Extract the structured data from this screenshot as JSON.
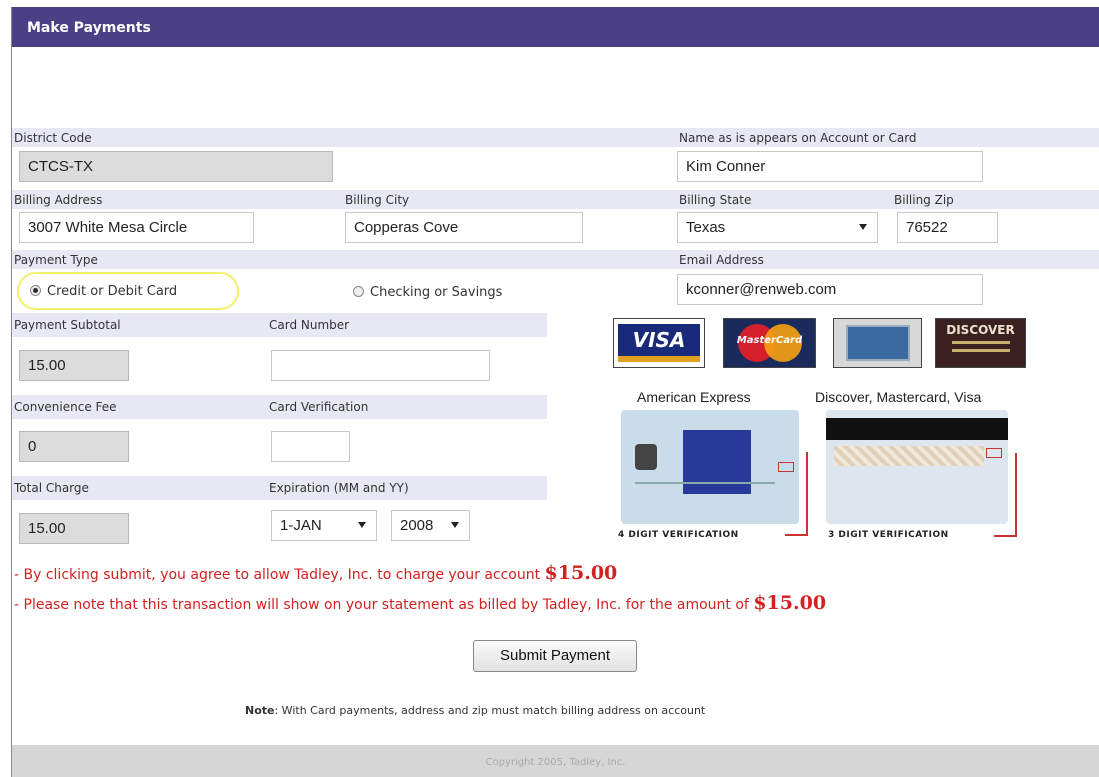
{
  "header": {
    "title": "Make Payments"
  },
  "labels": {
    "district_code": "District Code",
    "name_on_card": "Name as is appears on Account or Card",
    "billing_address": "Billing Address",
    "billing_city": "Billing City",
    "billing_state": "Billing State",
    "billing_zip": "Billing Zip",
    "payment_type": "Payment Type",
    "email": "Email Address",
    "payment_subtotal": "Payment Subtotal",
    "card_number": "Card Number",
    "convenience_fee": "Convenience Fee",
    "card_verification": "Card Verification",
    "total_charge": "Total Charge",
    "expiration": "Expiration (MM and YY)"
  },
  "fields": {
    "district_code": "CTCS-TX",
    "name_on_card": "Kim Conner",
    "billing_address": "3007 White Mesa Circle",
    "billing_city": "Copperas Cove",
    "billing_state": "Texas",
    "billing_zip": "76522",
    "email": "kconner@renweb.com",
    "payment_subtotal": "15.00",
    "card_number": "",
    "convenience_fee": "0",
    "card_verification": "",
    "total_charge": "15.00",
    "exp_month": "1-JAN",
    "exp_year": "2008"
  },
  "payment_type": {
    "option_card": "Credit or Debit Card",
    "option_check": "Checking or Savings",
    "selected": "card"
  },
  "cards": {
    "visa": "VISA",
    "mastercard": "MasterCard",
    "discover": "DISCOVER",
    "amex_caption": "American Express",
    "others_caption": "Discover, Mastercard, Visa",
    "amex_verif": "4 DIGIT VERIFICATION",
    "others_verif": "3 DIGIT VERIFICATION"
  },
  "notices": {
    "line1_text": "- By clicking submit, you agree to allow Tadley, Inc. to charge your account",
    "line1_amount": "$15.00",
    "line2_text": "- Please note that this transaction will show on your statement as billed by Tadley, Inc. for the amount of",
    "line2_amount": "$15.00"
  },
  "submit_label": "Submit Payment",
  "note": {
    "bold": "Note",
    "text": ": With Card payments, address and zip must match billing address on account"
  },
  "footer": "Copyright 2005, Tadley, Inc.",
  "colors": {
    "header": "#4b3f86",
    "band": "#e8e8f4",
    "notice": "#d42020"
  }
}
